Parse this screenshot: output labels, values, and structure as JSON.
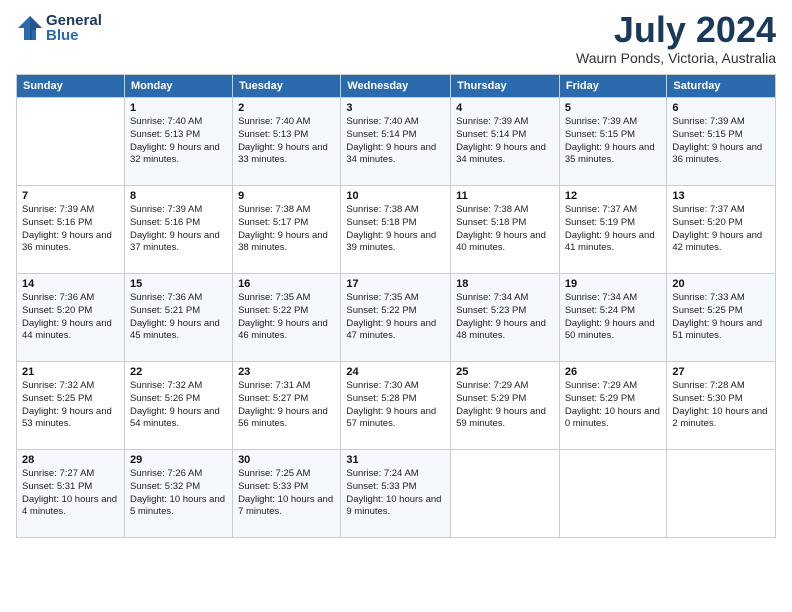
{
  "header": {
    "logo_line1": "General",
    "logo_line2": "Blue",
    "month": "July 2024",
    "location": "Waurn Ponds, Victoria, Australia"
  },
  "weekdays": [
    "Sunday",
    "Monday",
    "Tuesday",
    "Wednesday",
    "Thursday",
    "Friday",
    "Saturday"
  ],
  "weeks": [
    [
      {
        "day": "",
        "sunrise": "",
        "sunset": "",
        "daylight": ""
      },
      {
        "day": "1",
        "sunrise": "Sunrise: 7:40 AM",
        "sunset": "Sunset: 5:13 PM",
        "daylight": "Daylight: 9 hours and 32 minutes."
      },
      {
        "day": "2",
        "sunrise": "Sunrise: 7:40 AM",
        "sunset": "Sunset: 5:13 PM",
        "daylight": "Daylight: 9 hours and 33 minutes."
      },
      {
        "day": "3",
        "sunrise": "Sunrise: 7:40 AM",
        "sunset": "Sunset: 5:14 PM",
        "daylight": "Daylight: 9 hours and 34 minutes."
      },
      {
        "day": "4",
        "sunrise": "Sunrise: 7:39 AM",
        "sunset": "Sunset: 5:14 PM",
        "daylight": "Daylight: 9 hours and 34 minutes."
      },
      {
        "day": "5",
        "sunrise": "Sunrise: 7:39 AM",
        "sunset": "Sunset: 5:15 PM",
        "daylight": "Daylight: 9 hours and 35 minutes."
      },
      {
        "day": "6",
        "sunrise": "Sunrise: 7:39 AM",
        "sunset": "Sunset: 5:15 PM",
        "daylight": "Daylight: 9 hours and 36 minutes."
      }
    ],
    [
      {
        "day": "7",
        "sunrise": "Sunrise: 7:39 AM",
        "sunset": "Sunset: 5:16 PM",
        "daylight": "Daylight: 9 hours and 36 minutes."
      },
      {
        "day": "8",
        "sunrise": "Sunrise: 7:39 AM",
        "sunset": "Sunset: 5:16 PM",
        "daylight": "Daylight: 9 hours and 37 minutes."
      },
      {
        "day": "9",
        "sunrise": "Sunrise: 7:38 AM",
        "sunset": "Sunset: 5:17 PM",
        "daylight": "Daylight: 9 hours and 38 minutes."
      },
      {
        "day": "10",
        "sunrise": "Sunrise: 7:38 AM",
        "sunset": "Sunset: 5:18 PM",
        "daylight": "Daylight: 9 hours and 39 minutes."
      },
      {
        "day": "11",
        "sunrise": "Sunrise: 7:38 AM",
        "sunset": "Sunset: 5:18 PM",
        "daylight": "Daylight: 9 hours and 40 minutes."
      },
      {
        "day": "12",
        "sunrise": "Sunrise: 7:37 AM",
        "sunset": "Sunset: 5:19 PM",
        "daylight": "Daylight: 9 hours and 41 minutes."
      },
      {
        "day": "13",
        "sunrise": "Sunrise: 7:37 AM",
        "sunset": "Sunset: 5:20 PM",
        "daylight": "Daylight: 9 hours and 42 minutes."
      }
    ],
    [
      {
        "day": "14",
        "sunrise": "Sunrise: 7:36 AM",
        "sunset": "Sunset: 5:20 PM",
        "daylight": "Daylight: 9 hours and 44 minutes."
      },
      {
        "day": "15",
        "sunrise": "Sunrise: 7:36 AM",
        "sunset": "Sunset: 5:21 PM",
        "daylight": "Daylight: 9 hours and 45 minutes."
      },
      {
        "day": "16",
        "sunrise": "Sunrise: 7:35 AM",
        "sunset": "Sunset: 5:22 PM",
        "daylight": "Daylight: 9 hours and 46 minutes."
      },
      {
        "day": "17",
        "sunrise": "Sunrise: 7:35 AM",
        "sunset": "Sunset: 5:22 PM",
        "daylight": "Daylight: 9 hours and 47 minutes."
      },
      {
        "day": "18",
        "sunrise": "Sunrise: 7:34 AM",
        "sunset": "Sunset: 5:23 PM",
        "daylight": "Daylight: 9 hours and 48 minutes."
      },
      {
        "day": "19",
        "sunrise": "Sunrise: 7:34 AM",
        "sunset": "Sunset: 5:24 PM",
        "daylight": "Daylight: 9 hours and 50 minutes."
      },
      {
        "day": "20",
        "sunrise": "Sunrise: 7:33 AM",
        "sunset": "Sunset: 5:25 PM",
        "daylight": "Daylight: 9 hours and 51 minutes."
      }
    ],
    [
      {
        "day": "21",
        "sunrise": "Sunrise: 7:32 AM",
        "sunset": "Sunset: 5:25 PM",
        "daylight": "Daylight: 9 hours and 53 minutes."
      },
      {
        "day": "22",
        "sunrise": "Sunrise: 7:32 AM",
        "sunset": "Sunset: 5:26 PM",
        "daylight": "Daylight: 9 hours and 54 minutes."
      },
      {
        "day": "23",
        "sunrise": "Sunrise: 7:31 AM",
        "sunset": "Sunset: 5:27 PM",
        "daylight": "Daylight: 9 hours and 56 minutes."
      },
      {
        "day": "24",
        "sunrise": "Sunrise: 7:30 AM",
        "sunset": "Sunset: 5:28 PM",
        "daylight": "Daylight: 9 hours and 57 minutes."
      },
      {
        "day": "25",
        "sunrise": "Sunrise: 7:29 AM",
        "sunset": "Sunset: 5:29 PM",
        "daylight": "Daylight: 9 hours and 59 minutes."
      },
      {
        "day": "26",
        "sunrise": "Sunrise: 7:29 AM",
        "sunset": "Sunset: 5:29 PM",
        "daylight": "Daylight: 10 hours and 0 minutes."
      },
      {
        "day": "27",
        "sunrise": "Sunrise: 7:28 AM",
        "sunset": "Sunset: 5:30 PM",
        "daylight": "Daylight: 10 hours and 2 minutes."
      }
    ],
    [
      {
        "day": "28",
        "sunrise": "Sunrise: 7:27 AM",
        "sunset": "Sunset: 5:31 PM",
        "daylight": "Daylight: 10 hours and 4 minutes."
      },
      {
        "day": "29",
        "sunrise": "Sunrise: 7:26 AM",
        "sunset": "Sunset: 5:32 PM",
        "daylight": "Daylight: 10 hours and 5 minutes."
      },
      {
        "day": "30",
        "sunrise": "Sunrise: 7:25 AM",
        "sunset": "Sunset: 5:33 PM",
        "daylight": "Daylight: 10 hours and 7 minutes."
      },
      {
        "day": "31",
        "sunrise": "Sunrise: 7:24 AM",
        "sunset": "Sunset: 5:33 PM",
        "daylight": "Daylight: 10 hours and 9 minutes."
      },
      {
        "day": "",
        "sunrise": "",
        "sunset": "",
        "daylight": ""
      },
      {
        "day": "",
        "sunrise": "",
        "sunset": "",
        "daylight": ""
      },
      {
        "day": "",
        "sunrise": "",
        "sunset": "",
        "daylight": ""
      }
    ]
  ]
}
